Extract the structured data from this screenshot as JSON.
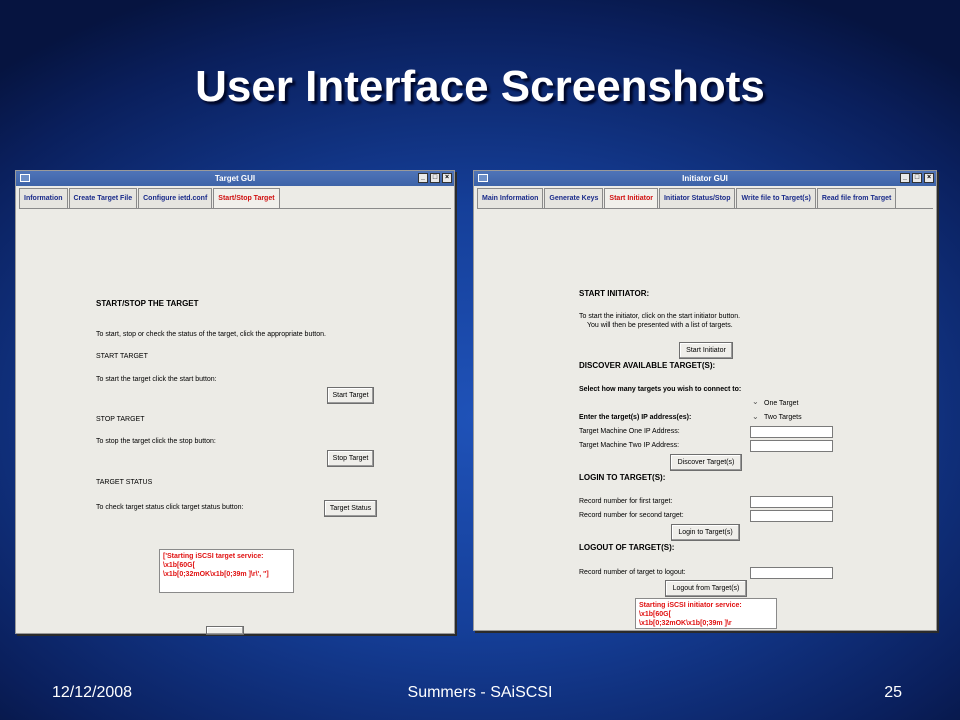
{
  "slide": {
    "title": "User Interface Screenshots",
    "footer_date": "12/12/2008",
    "footer_center": "Summers - SAiSCSI",
    "footer_page": "25"
  },
  "target_gui": {
    "title": "Target GUI",
    "tabs": [
      "Information",
      "Create Target File",
      "Configure ietd.conf",
      "Start/Stop Target"
    ],
    "heading": "START/STOP THE TARGET",
    "intro": "To start, stop or check the status of the target, click the appropriate button.",
    "start_section": "START TARGET",
    "start_text": "To start the target click the start button:",
    "start_button": "Start Target",
    "stop_section": "STOP TARGET",
    "stop_text": "To stop the target click the stop button:",
    "stop_button": "Stop Target",
    "status_section": "TARGET STATUS",
    "status_text": "To check target status click target status button:",
    "status_button": "Target Status",
    "log_line1": "['Starting iSCSI target service: \\x1b[60G[",
    "log_line2": "\\x1b[0;32mOK\\x1b[0;39m  ]\\r\\', '']"
  },
  "initiator_gui": {
    "title": "Initiator GUI",
    "tabs": [
      "Main Information",
      "Generate Keys",
      "Start Initiator",
      "Initiator Status/Stop",
      "Write file to Target(s)",
      "Read file from Target"
    ],
    "start_heading": "START INITIATOR:",
    "start_text1": "To start the initiator, click on the start initiator button.",
    "start_text2": "You will then be presented with a list of targets.",
    "start_button": "Start Initiator",
    "discover_heading": "DISCOVER AVAILABLE TARGET(S):",
    "select_prompt": "Select how many targets you wish to connect to:",
    "option_one": "One Target",
    "option_two": "Two Targets",
    "ip_prompt": "Enter the target(s) IP address(es):",
    "ip_one_label": "Target Machine One IP Address:",
    "ip_two_label": "Target Machine Two IP Address:",
    "discover_button": "Discover Target(s)",
    "login_heading": "LOGIN TO TARGET(S):",
    "record_first_label": "Record number for first target:",
    "record_second_label": "Record number for second target:",
    "login_button": "Login to Target(s)",
    "logout_heading": "LOGOUT OF TARGET(S):",
    "logout_record_label": "Record number of target to logout:",
    "logout_button": "Logout from Target(s)",
    "log_line1": "Starting iSCSI initiator service: \\x1b[60G[",
    "log_line2": "\\x1b[0;32mOK\\x1b[0;39m  ]\\r"
  }
}
